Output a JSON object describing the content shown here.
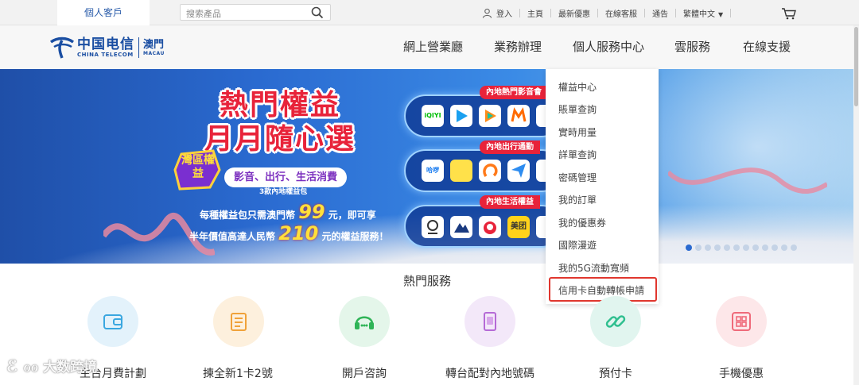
{
  "topbar": {
    "tab_label": "個人客戶",
    "search_placeholder": "搜索產品",
    "links": [
      "登入",
      "主頁",
      "最新優惠",
      "在線客服",
      "通告",
      "繁體中文"
    ]
  },
  "header": {
    "logo_cn": "中国电信",
    "logo_en": "CHINA TELECOM",
    "logo_region_cn": "澳門",
    "logo_region_en": "MACAU",
    "nav": [
      "網上營業廳",
      "業務辦理",
      "個人服務中心",
      "雲服務",
      "在線支援"
    ]
  },
  "banner": {
    "title_line1": "熱門權益",
    "title_line2": "月月隨心選",
    "badge": "灣區權益",
    "pill": "影音、出行、生活消費",
    "sub": "3款內地權益包",
    "line1_pre": "每種權益包只需澳門幣",
    "line1_num": "99",
    "line1_post": "元，即可享",
    "line2_pre": "半年價值高達人民幣",
    "line2_num": "210",
    "line2_post": "元的權益服務！",
    "groups": [
      {
        "tag": "內地熱門影音會",
        "apps": [
          "iQIYI",
          "",
          "",
          "",
          ""
        ]
      },
      {
        "tag": "內地出行通勤",
        "apps": [
          "哈啰",
          "",
          "",
          "",
          ""
        ]
      },
      {
        "tag": "內地生活權益",
        "apps": [
          "",
          "",
          "",
          "美团",
          ""
        ]
      }
    ],
    "slide_count": 12,
    "active_slide": 0
  },
  "dropdown": {
    "items": [
      "權益中心",
      "賬單查詢",
      "實時用量",
      "詳單查詢",
      "密碼管理",
      "我的訂單",
      "我的優惠券",
      "國際漫遊",
      "我的5G流動寬頻",
      "信用卡自動轉帳申請"
    ],
    "highlighted_index": 9,
    "highlight_color": "#e0362e"
  },
  "hot_services": {
    "title": "熱門服務",
    "items": [
      {
        "label": "主台月費計劃",
        "icon": "wallet-icon",
        "color": "#e3f2fb"
      },
      {
        "label": "揀全新1卡2號",
        "icon": "document-icon",
        "color": "#fdf0dd"
      },
      {
        "label": "開戶咨詢",
        "icon": "headset-icon",
        "color": "#e4f6ea"
      },
      {
        "label": "轉台配對內地號碼",
        "icon": "phone-card-icon",
        "color": "#f3e8f9"
      },
      {
        "label": "預付卡",
        "icon": "link-icon",
        "color": "#e1f5ef"
      },
      {
        "label": "手機優惠",
        "icon": "grid-icon",
        "color": "#fde7e9"
      }
    ]
  },
  "watermark": "大数跨境",
  "colors": {
    "brand_blue": "#1a4ea2",
    "accent_red": "#e8233a",
    "link_blue": "#2a5caa"
  }
}
